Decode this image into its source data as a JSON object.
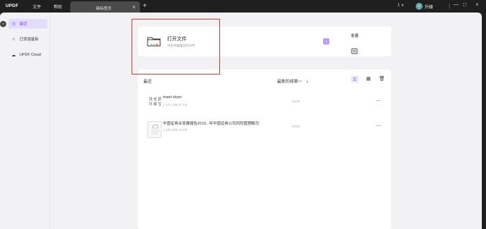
{
  "titlebar": {
    "logo_a": "UPDF",
    "logo_b": "",
    "menu_file": "文件",
    "menu_help": "帮助",
    "tab_title": "新标签页",
    "tab_close": "×",
    "new_tab": "+",
    "version_selector": "1 ∨",
    "avatar_letter": "U",
    "upgrade_label": "升级",
    "minimize": "—",
    "maximize": "□",
    "close": "×"
  },
  "sidebar": {
    "collapse": "›",
    "items": [
      {
        "label": "最近",
        "icon": "clock-icon",
        "active": true
      },
      {
        "label": "已添加星标",
        "icon": "star-icon",
        "active": false
      },
      {
        "label": "UPDF Cloud",
        "icon": "cloud-icon",
        "active": false
      }
    ]
  },
  "open_card": {
    "title": "打开文件",
    "subtitle": "浏览并编辑您的文件",
    "badge": "i"
  },
  "batch_card": {
    "title": "批量"
  },
  "list": {
    "header_left": "最近",
    "sort_label": "最新的排第一",
    "sort_caret": "▾",
    "view_list_icon": "list-view-icon",
    "view_grid_icon": "grid-view-icon",
    "delete_icon": "trash-icon",
    "files": [
      {
        "name": "towel-dryer",
        "meta": "1/1  |  158.37 KB",
        "date": "01/26",
        "more": "···",
        "thumb": "陆 佳 振\n托 毓 宝"
      },
      {
        "name": "中国证券业发展报告2019...年中国证券公司风险管理概况",
        "meta": "1/8  |  906.72 KB",
        "date": "01/26",
        "more": "···",
        "thumb": ""
      }
    ]
  },
  "colors": {
    "accent": "#7a3cff",
    "highlight_box": "#e03030",
    "titlebar_bg": "#1f1f1f"
  }
}
